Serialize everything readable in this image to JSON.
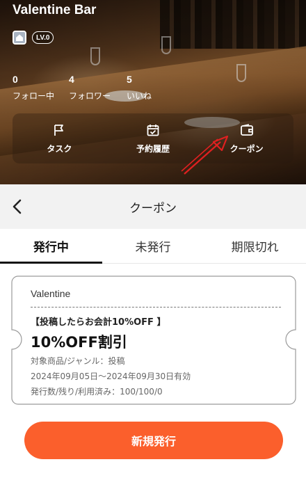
{
  "profile": {
    "bar_name": "Valentine Bar",
    "level_badge": "LV.0",
    "stats": [
      {
        "value": "0",
        "label": "フォロー中"
      },
      {
        "value": "4",
        "label": "フォロワー"
      },
      {
        "value": "5",
        "label": "いいね"
      }
    ],
    "actions": [
      {
        "label": "タスク",
        "icon": "flag-icon"
      },
      {
        "label": "予約履歴",
        "icon": "calendar-check-icon"
      },
      {
        "label": "クーポン",
        "icon": "wallet-icon"
      }
    ]
  },
  "annotation": {
    "color": "#e02020"
  },
  "page": {
    "title": "クーポン",
    "tabs": [
      {
        "label": "発行中",
        "active": true
      },
      {
        "label": "未発行",
        "active": false
      },
      {
        "label": "期限切れ",
        "active": false
      }
    ]
  },
  "coupon": {
    "store": "Valentine",
    "headline": "【投稿したらお会計10%OFF 】",
    "title": "10%OFF割引",
    "category": "対象商品/ジャンル：投稿",
    "validity": "2024年09月05日～2024年09月30日有効",
    "counts": "発行数/残り/利用済み：100/100/0"
  },
  "new_button_label": "新規発行",
  "colors": {
    "accent": "#fb5f2c",
    "tab_indicator": "#111111"
  }
}
